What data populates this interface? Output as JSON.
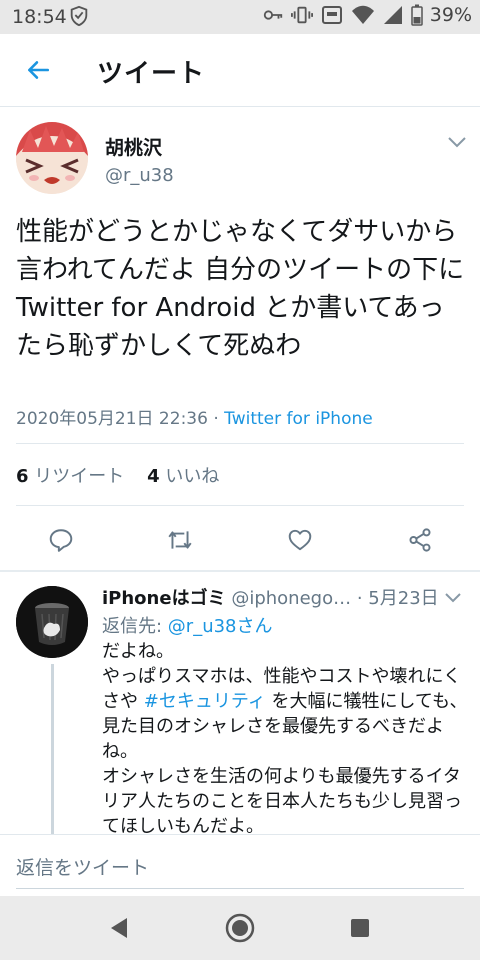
{
  "status_bar": {
    "time": "18:54",
    "battery": "39%"
  },
  "header": {
    "title": "ツイート"
  },
  "tweet": {
    "author_name": "胡桃沢",
    "author_handle": "@r_u38",
    "text": "性能がどうとかじゃなくてダサいから言われてんだよ 自分のツイートの下に Twitter for Android とか書いてあったら恥ずかしくて死ぬわ",
    "datetime": "2020年05月21日 22:36",
    "meta_sep": " · ",
    "via": "Twitter for iPhone",
    "retweet_count": "6",
    "retweet_label": "リツイート",
    "like_count": "4",
    "like_label": "いいね"
  },
  "reply": {
    "author_name": "iPhoneはゴミ",
    "author_handle": "@iphonego…",
    "date": "5月23日",
    "replying_label": "返信先: ",
    "replying_to": "@r_u38さん",
    "text_before_hashtag": "だよね。\nやっぱりスマホは、性能やコストや壊れにくさや ",
    "hashtag": "#セキュリティ",
    "text_after_hashtag": " を大幅に犠牲にしても、見た目のオシャレさを最優先するべきだよね。\nオシャレさを生活の何よりも最優先するイタリア人たちのことを日本人たちも少し見習ってほしいもんだよ。"
  },
  "composer": {
    "placeholder": "返信をツイート"
  },
  "colors": {
    "accent": "#1b95e0",
    "secondary_text": "#657786",
    "divider": "#e1e8ed"
  }
}
